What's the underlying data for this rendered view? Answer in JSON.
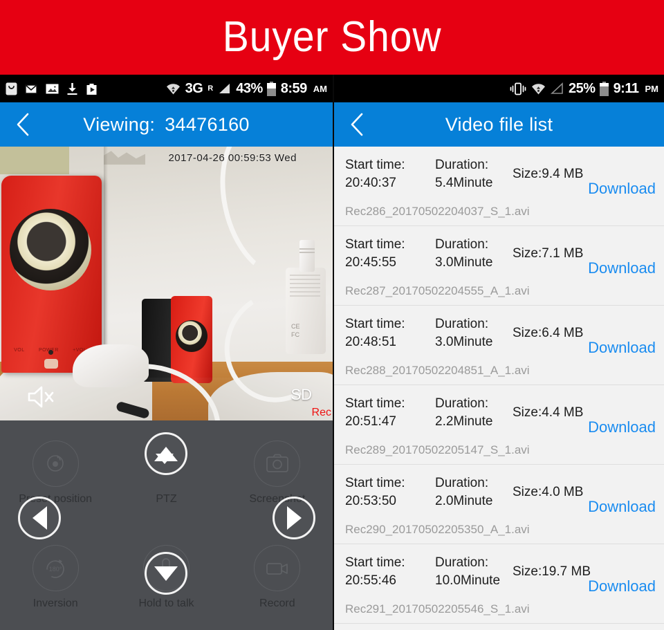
{
  "banner": {
    "title": "Buyer Show"
  },
  "left_phone": {
    "status_bar": {
      "icons": [
        "shopping-bag-icon",
        "email-icon",
        "photo-icon",
        "download-icon",
        "play-store-icon"
      ],
      "network_type": "3G",
      "network_sup": "R",
      "battery_percent": "43%",
      "battery_level": 43,
      "clock": "8:59",
      "clock_meridiem": "AM"
    },
    "appbar": {
      "back": "back-chevron",
      "title": "Viewing:",
      "device_id": "34476160"
    },
    "video": {
      "timestamp": "2017-04-26  00:59:53  Wed",
      "mute_icon": "speaker-mute-icon",
      "quality_label": "SD",
      "recording_label": "Rec"
    },
    "controls": [
      {
        "label": "Preset position",
        "icon": "preset-position-icon"
      },
      {
        "label": "PTZ",
        "icon": "ptz-icon"
      },
      {
        "label": "Screenshot",
        "icon": "camera-icon"
      },
      {
        "label": "Inversion",
        "icon": "rotate-180-icon"
      },
      {
        "label": "Hold to talk",
        "icon": "microphone-icon"
      },
      {
        "label": "Record",
        "icon": "video-camera-icon"
      }
    ],
    "ptz_pad": {
      "up": "arrow-up",
      "down": "arrow-down",
      "left": "arrow-left",
      "right": "arrow-right"
    }
  },
  "right_phone": {
    "status_bar": {
      "icons": [
        "vibrate-icon",
        "wifi-icon",
        "signal-icon"
      ],
      "battery_percent": "25%",
      "battery_level": 25,
      "clock": "9:11",
      "clock_meridiem": "PM"
    },
    "appbar": {
      "back": "back-chevron",
      "title": "Video file list"
    },
    "labels": {
      "start_time": "Start time:",
      "duration": "Duration:",
      "download": "Download"
    },
    "files": [
      {
        "start_time": "20:40:37",
        "duration": "5.4Minute",
        "size": "Size:9.4 MB",
        "filename": "Rec286_20170502204037_S_1.avi",
        "download": "Download"
      },
      {
        "start_time": "20:45:55",
        "duration": "3.0Minute",
        "size": "Size:7.1 MB",
        "filename": "Rec287_20170502204555_A_1.avi",
        "download": "Download"
      },
      {
        "start_time": "20:48:51",
        "duration": "3.0Minute",
        "size": "Size:6.4 MB",
        "filename": "Rec288_20170502204851_A_1.avi",
        "download": "Download"
      },
      {
        "start_time": "20:51:47",
        "duration": "2.2Minute",
        "size": "Size:4.4 MB",
        "filename": "Rec289_20170502205147_S_1.avi",
        "download": "Download"
      },
      {
        "start_time": "20:53:50",
        "duration": "2.0Minute",
        "size": "Size:4.0 MB",
        "filename": "Rec290_20170502205350_A_1.avi",
        "download": "Download"
      },
      {
        "start_time": "20:55:46",
        "duration": "10.0Minute",
        "size": "Size:19.7 MB",
        "filename": "Rec291_20170502205546_S_1.avi",
        "download": "Download"
      }
    ]
  },
  "colors": {
    "banner_red": "#e60012",
    "appbar_blue": "#0680d8",
    "link_blue": "#1a8cf0",
    "controls_gray": "#4c4e52",
    "list_bg": "#f2f2f2",
    "rec_red": "#ef1111"
  }
}
